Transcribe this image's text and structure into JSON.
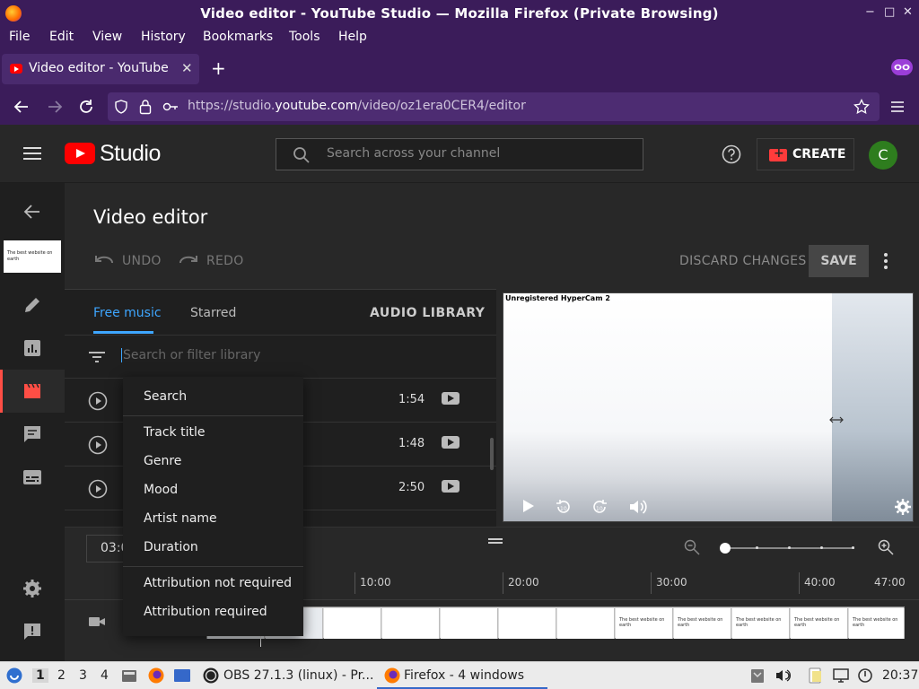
{
  "window": {
    "title": "Video editor - YouTube Studio — Mozilla Firefox (Private Browsing)",
    "controls": [
      "−",
      "□",
      "✕"
    ]
  },
  "menubar": {
    "items": [
      {
        "label": "File"
      },
      {
        "label": "Edit"
      },
      {
        "label": "View"
      },
      {
        "label": "History"
      },
      {
        "label": "Bookmarks"
      },
      {
        "label": "Tools"
      },
      {
        "label": "Help"
      }
    ]
  },
  "browser": {
    "tab_title": "Video editor - YouTube Studio",
    "tab_close": "✕",
    "new_tab": "+",
    "url_prefix": "https://studio.",
    "url_domain": "youtube.com",
    "url_path": "/video/oz1era0CER4/editor"
  },
  "studio": {
    "logo_text": "Studio",
    "search_placeholder": "Search across your channel",
    "create_label": "CREATE",
    "avatar_letter": "C",
    "thumb_text": "The best website on earth"
  },
  "editor": {
    "title": "Video editor",
    "undo_label": "UNDO",
    "redo_label": "REDO",
    "discard_label": "DISCARD CHANGES",
    "save_label": "SAVE"
  },
  "music": {
    "tabs": [
      {
        "label": "Free music",
        "active": true
      },
      {
        "label": "Starred",
        "active": false
      }
    ],
    "audio_library_label": "AUDIO LIBRARY",
    "filter_placeholder": "Search or filter library",
    "tracks": [
      {
        "duration": "1:54"
      },
      {
        "duration": "1:48"
      },
      {
        "duration": "2:50"
      }
    ]
  },
  "preview": {
    "watermark": "Unregistered HyperCam 2"
  },
  "timeline": {
    "time_value": "03:0",
    "ruler": [
      "10:00",
      "20:00",
      "30:00",
      "40:00",
      "47:00"
    ],
    "frame_text": "The best website on earth"
  },
  "filter_menu": {
    "options": [
      {
        "label": "Search"
      },
      {
        "label": "Track title"
      },
      {
        "label": "Genre"
      },
      {
        "label": "Mood"
      },
      {
        "label": "Artist name"
      },
      {
        "label": "Duration"
      },
      {
        "label": "Attribution not required"
      },
      {
        "label": "Attribution required"
      }
    ]
  },
  "taskbar": {
    "workspaces": [
      "1",
      "2",
      "3",
      "4"
    ],
    "tasks": [
      {
        "label": "OBS 27.1.3 (linux) - Pr..."
      },
      {
        "label": "Firefox - 4 windows"
      }
    ],
    "clock": "20:37"
  },
  "colors": {
    "accent_blue": "#3ea6ff",
    "youtube_red": "#ff0000",
    "firefox_purple": "#3b1c5a"
  }
}
